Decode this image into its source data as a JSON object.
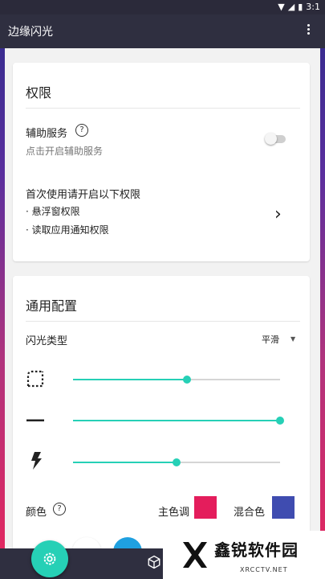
{
  "status_bar": {
    "time": "3:1",
    "icons": [
      "wifi-icon",
      "signal-icon",
      "battery-icon"
    ]
  },
  "app_bar": {
    "title": "边缘闪光",
    "menu_icon": "more-vert-icon"
  },
  "permissions_card": {
    "title": "权限",
    "accessibility": {
      "label": "辅助服务",
      "help_icon": "help-icon",
      "help_glyph": "?",
      "description": "点击开启辅助服务",
      "enabled": false
    },
    "first_use": {
      "label": "首次使用请开启以下权限",
      "items": [
        "· 悬浮窗权限",
        "· 读取应用通知权限"
      ],
      "chevron": "›"
    }
  },
  "general_card": {
    "title": "通用配置",
    "flash_type": {
      "label": "闪光类型",
      "value": "平滑",
      "caret": "▼"
    },
    "sliders": [
      {
        "icon": "corner-radius-icon",
        "value": 0.55
      },
      {
        "icon": "line-width-icon",
        "value": 1.0
      },
      {
        "icon": "flash-speed-icon",
        "value": 0.5
      }
    ],
    "color": {
      "label": "颜色",
      "help_glyph": "?",
      "primary_label": "主色调",
      "primary_color": "#e41d5c",
      "blend_label": "混合色",
      "blend_color": "#3f4cb0"
    }
  },
  "bottom_nav": {
    "fab_icon": "settings-icon",
    "circle_colors": [
      "#ffffff",
      "#1fa0e0"
    ],
    "cube_icon": "cube-icon"
  },
  "watermark": {
    "text": "鑫锐软件园",
    "url": "XRCCTV.NET",
    "logo_icon": "x-logo-icon"
  },
  "colors": {
    "accent": "#26d0b6",
    "appbar": "#2f2f40"
  }
}
